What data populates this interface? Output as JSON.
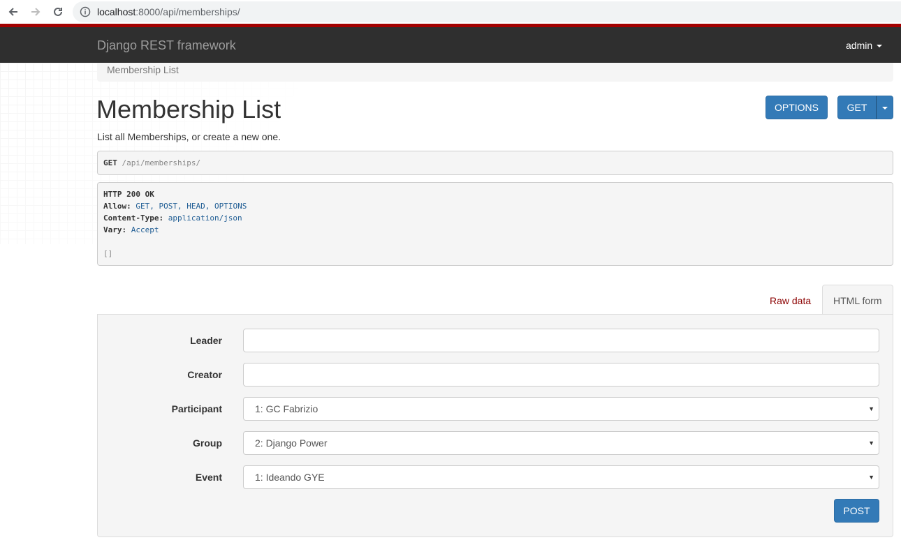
{
  "browser": {
    "url_host": "localhost",
    "url_path": ":8000/api/memberships/"
  },
  "navbar": {
    "brand": "Django REST framework",
    "user": "admin"
  },
  "breadcrumb": {
    "current": "Membership List"
  },
  "page": {
    "title": "Membership List",
    "description": "List all Memberships, or create a new one."
  },
  "actions": {
    "options_label": "OPTIONS",
    "get_label": "GET"
  },
  "request": {
    "method": "GET",
    "path": "/api/memberships/"
  },
  "response": {
    "status": "HTTP 200 OK",
    "allow_key": "Allow:",
    "allow_value": "GET, POST, HEAD, OPTIONS",
    "content_type_key": "Content-Type:",
    "content_type_value": "application/json",
    "vary_key": "Vary:",
    "vary_value": "Accept",
    "body": "[]"
  },
  "tabs": {
    "raw": "Raw data",
    "html": "HTML form"
  },
  "form": {
    "leader": {
      "label": "Leader",
      "value": ""
    },
    "creator": {
      "label": "Creator",
      "value": ""
    },
    "participant": {
      "label": "Participant",
      "value": "1: GC Fabrizio"
    },
    "group": {
      "label": "Group",
      "value": "2: Django Power"
    },
    "event": {
      "label": "Event",
      "value": "1: Ideando GYE"
    },
    "submit_label": "POST"
  },
  "colors": {
    "primary": "#337ab7",
    "navbar": "#2f2f2f",
    "accent_line": "#a30000"
  }
}
